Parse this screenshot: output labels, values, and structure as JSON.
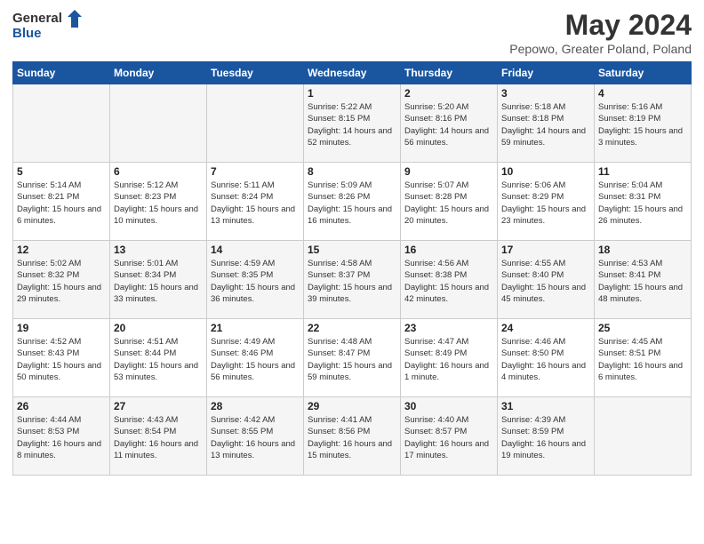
{
  "header": {
    "logo_general": "General",
    "logo_blue": "Blue",
    "month_title": "May 2024",
    "location": "Pepowo, Greater Poland, Poland"
  },
  "days_of_week": [
    "Sunday",
    "Monday",
    "Tuesday",
    "Wednesday",
    "Thursday",
    "Friday",
    "Saturday"
  ],
  "weeks": [
    [
      {
        "day": "",
        "info": ""
      },
      {
        "day": "",
        "info": ""
      },
      {
        "day": "",
        "info": ""
      },
      {
        "day": "1",
        "info": "Sunrise: 5:22 AM\nSunset: 8:15 PM\nDaylight: 14 hours and 52 minutes."
      },
      {
        "day": "2",
        "info": "Sunrise: 5:20 AM\nSunset: 8:16 PM\nDaylight: 14 hours and 56 minutes."
      },
      {
        "day": "3",
        "info": "Sunrise: 5:18 AM\nSunset: 8:18 PM\nDaylight: 14 hours and 59 minutes."
      },
      {
        "day": "4",
        "info": "Sunrise: 5:16 AM\nSunset: 8:19 PM\nDaylight: 15 hours and 3 minutes."
      }
    ],
    [
      {
        "day": "5",
        "info": "Sunrise: 5:14 AM\nSunset: 8:21 PM\nDaylight: 15 hours and 6 minutes."
      },
      {
        "day": "6",
        "info": "Sunrise: 5:12 AM\nSunset: 8:23 PM\nDaylight: 15 hours and 10 minutes."
      },
      {
        "day": "7",
        "info": "Sunrise: 5:11 AM\nSunset: 8:24 PM\nDaylight: 15 hours and 13 minutes."
      },
      {
        "day": "8",
        "info": "Sunrise: 5:09 AM\nSunset: 8:26 PM\nDaylight: 15 hours and 16 minutes."
      },
      {
        "day": "9",
        "info": "Sunrise: 5:07 AM\nSunset: 8:28 PM\nDaylight: 15 hours and 20 minutes."
      },
      {
        "day": "10",
        "info": "Sunrise: 5:06 AM\nSunset: 8:29 PM\nDaylight: 15 hours and 23 minutes."
      },
      {
        "day": "11",
        "info": "Sunrise: 5:04 AM\nSunset: 8:31 PM\nDaylight: 15 hours and 26 minutes."
      }
    ],
    [
      {
        "day": "12",
        "info": "Sunrise: 5:02 AM\nSunset: 8:32 PM\nDaylight: 15 hours and 29 minutes."
      },
      {
        "day": "13",
        "info": "Sunrise: 5:01 AM\nSunset: 8:34 PM\nDaylight: 15 hours and 33 minutes."
      },
      {
        "day": "14",
        "info": "Sunrise: 4:59 AM\nSunset: 8:35 PM\nDaylight: 15 hours and 36 minutes."
      },
      {
        "day": "15",
        "info": "Sunrise: 4:58 AM\nSunset: 8:37 PM\nDaylight: 15 hours and 39 minutes."
      },
      {
        "day": "16",
        "info": "Sunrise: 4:56 AM\nSunset: 8:38 PM\nDaylight: 15 hours and 42 minutes."
      },
      {
        "day": "17",
        "info": "Sunrise: 4:55 AM\nSunset: 8:40 PM\nDaylight: 15 hours and 45 minutes."
      },
      {
        "day": "18",
        "info": "Sunrise: 4:53 AM\nSunset: 8:41 PM\nDaylight: 15 hours and 48 minutes."
      }
    ],
    [
      {
        "day": "19",
        "info": "Sunrise: 4:52 AM\nSunset: 8:43 PM\nDaylight: 15 hours and 50 minutes."
      },
      {
        "day": "20",
        "info": "Sunrise: 4:51 AM\nSunset: 8:44 PM\nDaylight: 15 hours and 53 minutes."
      },
      {
        "day": "21",
        "info": "Sunrise: 4:49 AM\nSunset: 8:46 PM\nDaylight: 15 hours and 56 minutes."
      },
      {
        "day": "22",
        "info": "Sunrise: 4:48 AM\nSunset: 8:47 PM\nDaylight: 15 hours and 59 minutes."
      },
      {
        "day": "23",
        "info": "Sunrise: 4:47 AM\nSunset: 8:49 PM\nDaylight: 16 hours and 1 minute."
      },
      {
        "day": "24",
        "info": "Sunrise: 4:46 AM\nSunset: 8:50 PM\nDaylight: 16 hours and 4 minutes."
      },
      {
        "day": "25",
        "info": "Sunrise: 4:45 AM\nSunset: 8:51 PM\nDaylight: 16 hours and 6 minutes."
      }
    ],
    [
      {
        "day": "26",
        "info": "Sunrise: 4:44 AM\nSunset: 8:53 PM\nDaylight: 16 hours and 8 minutes."
      },
      {
        "day": "27",
        "info": "Sunrise: 4:43 AM\nSunset: 8:54 PM\nDaylight: 16 hours and 11 minutes."
      },
      {
        "day": "28",
        "info": "Sunrise: 4:42 AM\nSunset: 8:55 PM\nDaylight: 16 hours and 13 minutes."
      },
      {
        "day": "29",
        "info": "Sunrise: 4:41 AM\nSunset: 8:56 PM\nDaylight: 16 hours and 15 minutes."
      },
      {
        "day": "30",
        "info": "Sunrise: 4:40 AM\nSunset: 8:57 PM\nDaylight: 16 hours and 17 minutes."
      },
      {
        "day": "31",
        "info": "Sunrise: 4:39 AM\nSunset: 8:59 PM\nDaylight: 16 hours and 19 minutes."
      },
      {
        "day": "",
        "info": ""
      }
    ]
  ]
}
